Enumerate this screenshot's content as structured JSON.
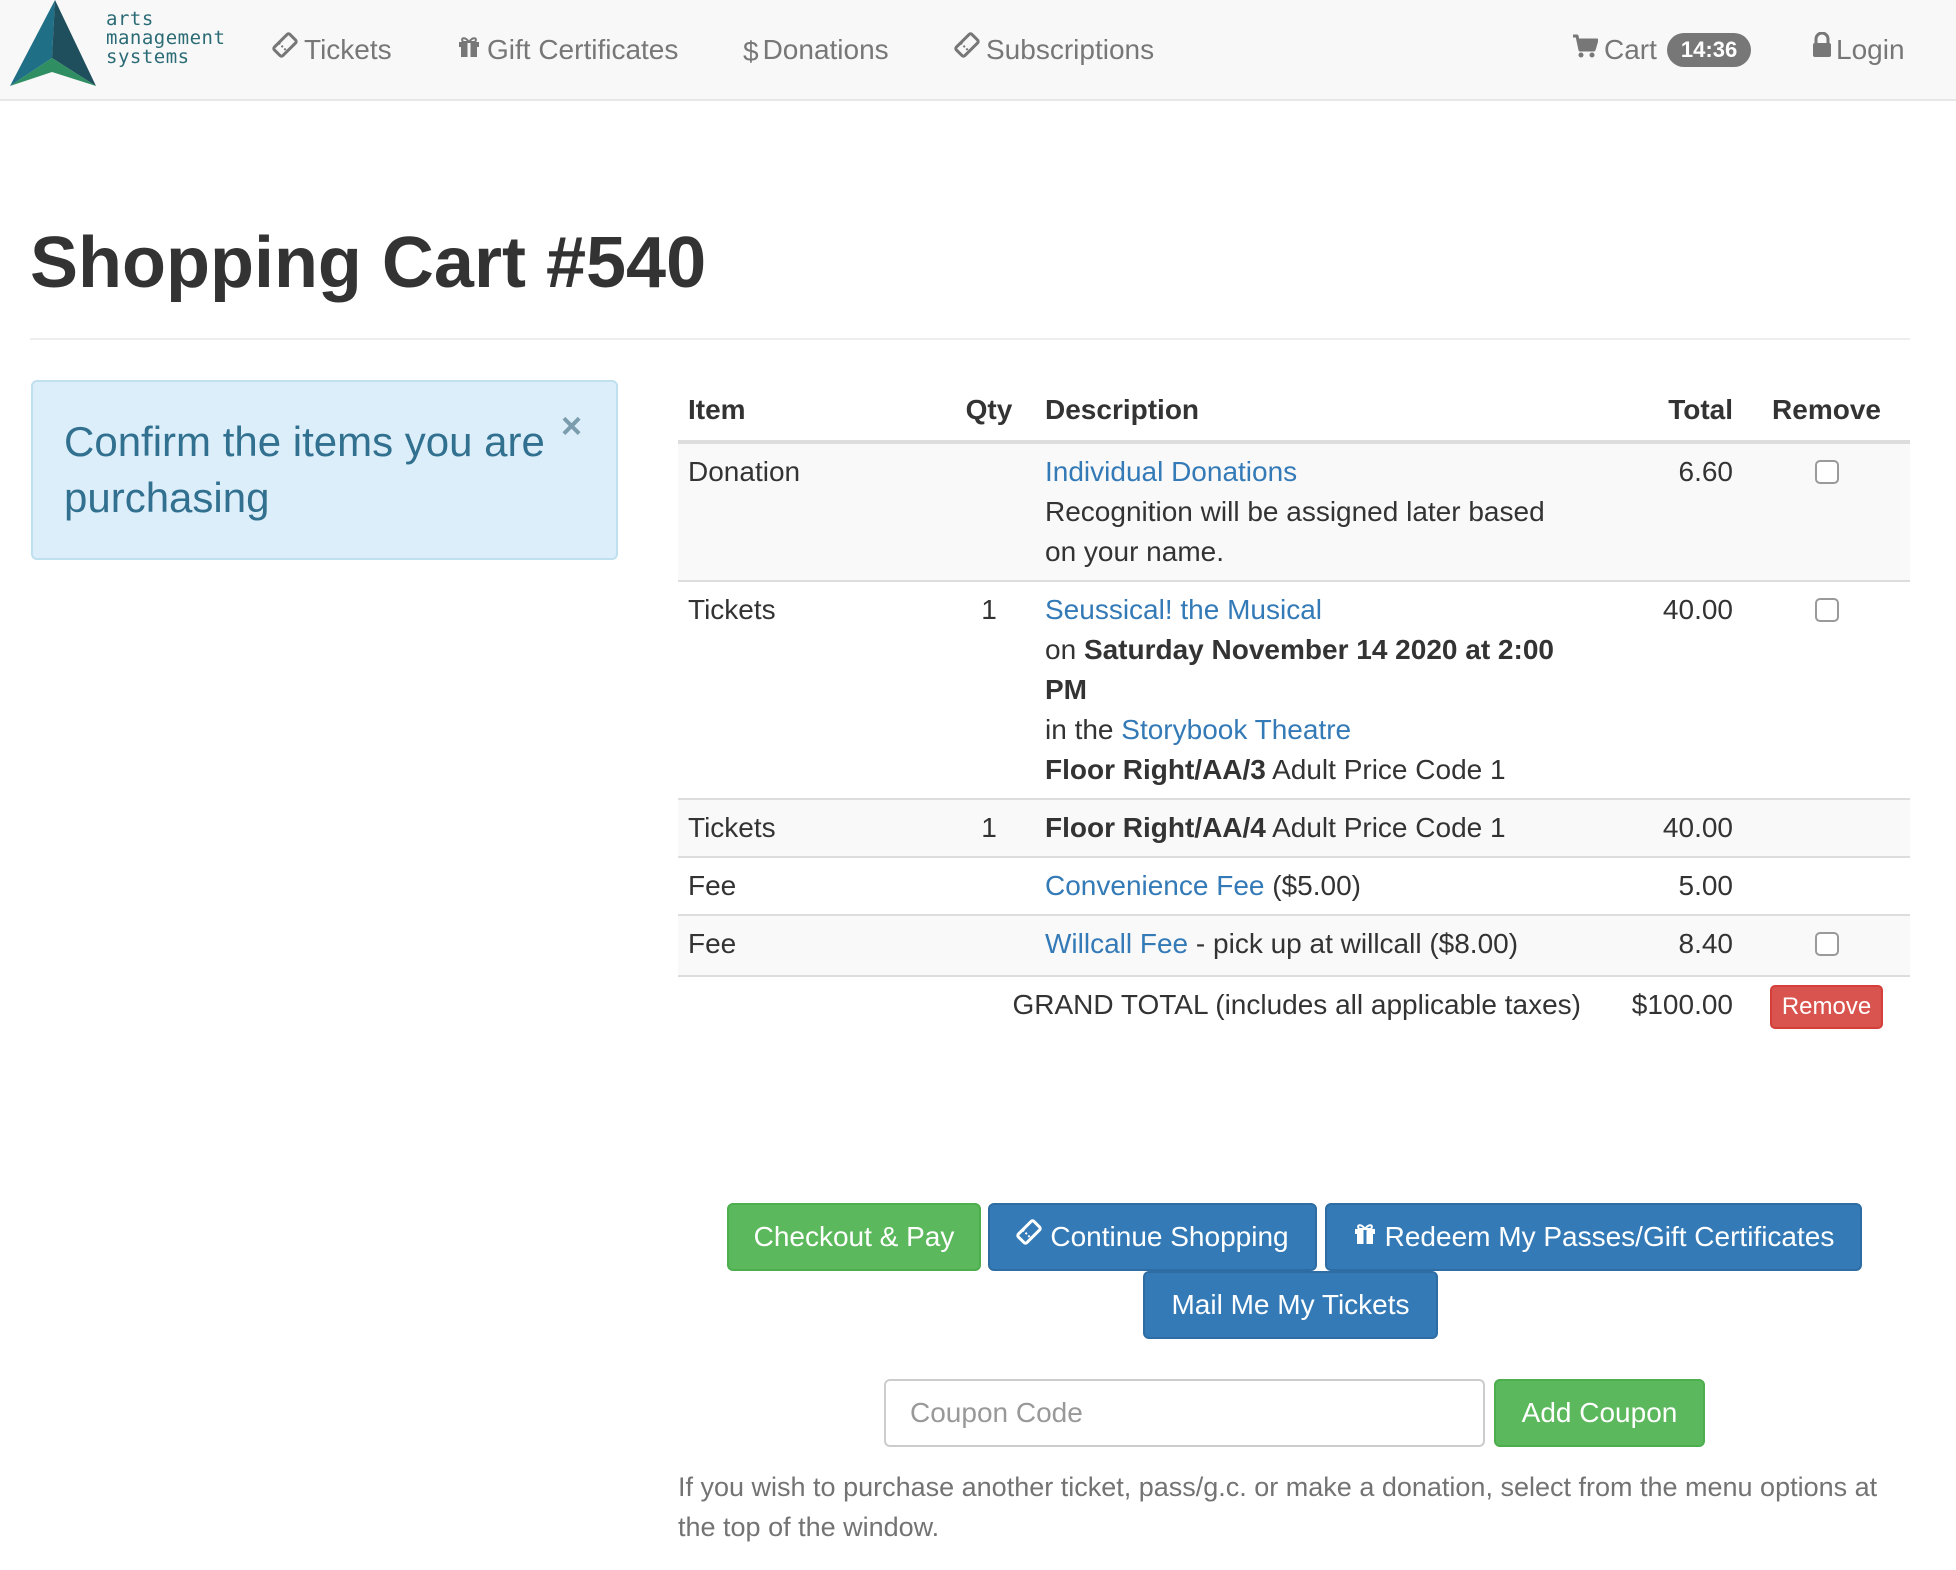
{
  "brand": {
    "lines": [
      "arts",
      "management",
      "systems"
    ],
    "colors": {
      "dark": "#1f4e5c",
      "green": "#2f8f62",
      "teal": "#2b6b76"
    }
  },
  "nav": {
    "tickets": {
      "label": "Tickets",
      "icon": "ticket-icon"
    },
    "gift_certificates": {
      "label": "Gift Certificates",
      "icon": "gift-icon"
    },
    "donations": {
      "label": "Donations",
      "icon": "dollar-icon"
    },
    "subscriptions": {
      "label": "Subscriptions",
      "icon": "ticket-icon"
    },
    "cart": {
      "label": "Cart",
      "icon": "cart-icon",
      "timer": "14:36"
    },
    "login": {
      "label": "Login",
      "icon": "lock-icon"
    }
  },
  "page": {
    "title": "Shopping Cart #540"
  },
  "alert": {
    "message": "Confirm the items you are purchasing",
    "close": "×"
  },
  "table": {
    "headers": {
      "item": "Item",
      "qty": "Qty",
      "description": "Description",
      "total": "Total",
      "remove": "Remove"
    },
    "rows": [
      {
        "item": "Donation",
        "qty": "",
        "total": "6.60",
        "desc_link": "Individual Donations",
        "desc_text": "Recognition will be assigned later based on your name."
      },
      {
        "item": "Tickets",
        "qty": "1",
        "total": "40.00",
        "desc_link": "Seussical! the Musical",
        "on_prefix": "on",
        "date": "Saturday November 14 2020 at 2:00 PM",
        "in_prefix": "in the",
        "venue": "Storybook Theatre",
        "seat": "Floor Right/AA/3",
        "price": "Adult Price Code 1"
      },
      {
        "item": "Tickets",
        "qty": "1",
        "total": "40.00",
        "seat": "Floor Right/AA/4",
        "price": "Adult Price Code 1"
      },
      {
        "item": "Fee",
        "qty": "",
        "total": "5.00",
        "desc_link": "Convenience Fee",
        "desc_text": "($5.00)"
      },
      {
        "item": "Fee",
        "qty": "",
        "total": "8.40",
        "desc_link": "Willcall Fee",
        "desc_text": "- pick up at willcall ($8.00)"
      }
    ],
    "grand_total_label": "GRAND TOTAL (includes all applicable taxes)",
    "grand_total": "$100.00",
    "remove_button": "Remove"
  },
  "actions": {
    "checkout": "Checkout & Pay",
    "continue": "Continue Shopping",
    "redeem": "Redeem My Passes/Gift Certificates",
    "mail": "Mail Me My Tickets"
  },
  "coupon": {
    "placeholder": "Coupon Code",
    "value": "",
    "button": "Add Coupon"
  },
  "help_text": "If you wish to purchase another ticket, pass/g.c. or make a donation, select from the menu options at the top of the window."
}
